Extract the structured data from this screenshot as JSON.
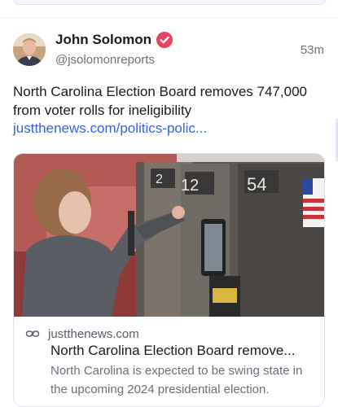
{
  "post": {
    "author_name": "John Solomon",
    "handle": "@jsolomonreports",
    "timestamp": "53m",
    "text": "North Carolina Election Board removes 747,000 from voter rolls for ineligibility",
    "link_text": "justthenews.com/politics-polic..."
  },
  "link_card": {
    "domain": "justthenews.com",
    "title": "North Carolina Election Board remove...",
    "description": "North Carolina is expected to be swing state in the upcoming 2024 presidential election.",
    "image_alt_labels": {
      "booth_a": "2",
      "booth_b": "12",
      "booth_c": "54"
    }
  },
  "colors": {
    "accent_link": "#3563e9",
    "verified_badge": "#e8435e",
    "muted_text": "#6e6f7a"
  },
  "icons": {
    "verified": "verified-badge-icon",
    "link": "link-chain-icon"
  }
}
